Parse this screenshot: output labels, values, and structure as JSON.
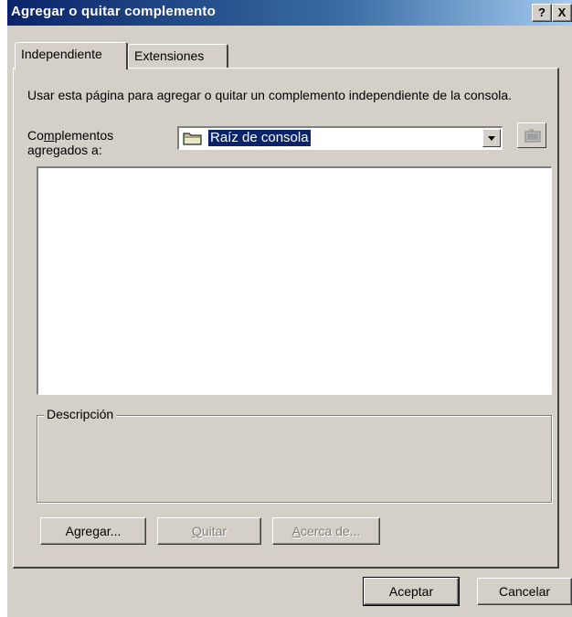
{
  "window": {
    "title": "Agregar o quitar complemento",
    "help_button": "?",
    "close_button": "X"
  },
  "tabs": [
    {
      "label": "Independiente",
      "active": true
    },
    {
      "label": "Extensiones",
      "active": false
    }
  ],
  "intro_text": "Usar esta página para agregar o quitar un complemento independiente de la consola.",
  "snapins_label": {
    "prefix": "Co",
    "mnemonic": "m",
    "suffix": "plementos",
    "line2": "agregados a:"
  },
  "combo": {
    "selected_value": "Raíz de consola",
    "icon": "folder-icon"
  },
  "up_level_icon": "up-folder-icon",
  "snapins_list": [],
  "description_group": {
    "label": "Descripción",
    "text": ""
  },
  "buttons": {
    "add": "Agregar...",
    "remove_mnemonic": "Q",
    "remove_rest": "uitar",
    "about_mnemonic": "A",
    "about_rest": "cerca de...",
    "ok": "Aceptar",
    "cancel": "Cancelar"
  },
  "colors": {
    "titlebar_start": "#0a246a",
    "titlebar_end": "#a6caf0",
    "face": "#d4d0c8",
    "selection": "#0a246a"
  }
}
